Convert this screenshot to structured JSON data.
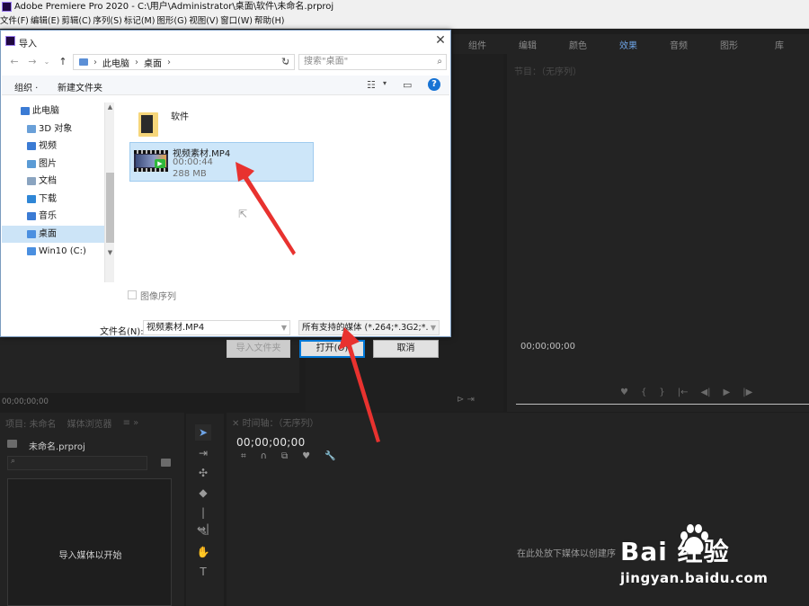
{
  "app": {
    "title": "Adobe Premiere Pro 2020 - C:\\用户\\Administrator\\桌面\\软件\\未命名.prproj",
    "menu": [
      "文件(F)",
      "编辑(E)",
      "剪辑(C)",
      "序列(S)",
      "标记(M)",
      "图形(G)",
      "视图(V)",
      "窗口(W)",
      "帮助(H)"
    ]
  },
  "workspace": {
    "tabs": [
      "组件",
      "编辑",
      "颜色",
      "效果",
      "音频",
      "图形",
      "库"
    ],
    "active_tab": "效果",
    "program_title": "节目：（无序列）",
    "program_timecode": "00;00;00;00",
    "source_timecode": "00;00;00;00",
    "project_tabs": [
      "项目: 未命名",
      "媒体浏览器"
    ],
    "project_file": "未命名.prproj",
    "project_empty": "导入媒体以开始",
    "timeline_tab": "时间轴：（无序列）",
    "timeline_timecode": "00;00;00;00",
    "timeline_drop_hint": "在此处放下媒体以创建序",
    "icons": {
      "tools": [
        "selection-tool-icon",
        "track-select-icon",
        "ripple-edit-icon",
        "razor-icon",
        "slip-icon",
        "pen-icon",
        "hand-icon",
        "type-icon"
      ]
    }
  },
  "dialog": {
    "title": "导入",
    "breadcrumb": [
      "此电脑",
      "桌面"
    ],
    "search_placeholder": "搜索\"桌面\"",
    "organize": "组织 ·",
    "new_folder": "新建文件夹",
    "tree": [
      {
        "label": "此电脑",
        "icon": "pc-icon",
        "color": "#3b7bd4"
      },
      {
        "label": "3D 对象",
        "icon": "objects-3d-icon",
        "color": "#6aa0d8"
      },
      {
        "label": "视频",
        "icon": "video-folder-icon",
        "color": "#3b7bd4"
      },
      {
        "label": "图片",
        "icon": "pictures-folder-icon",
        "color": "#5b9bd5"
      },
      {
        "label": "文档",
        "icon": "documents-folder-icon",
        "color": "#8aa4c0"
      },
      {
        "label": "下载",
        "icon": "downloads-folder-icon",
        "color": "#2f86d6"
      },
      {
        "label": "音乐",
        "icon": "music-folder-icon",
        "color": "#3b7bd4"
      },
      {
        "label": "桌面",
        "icon": "desktop-folder-icon",
        "color": "#4a8fe0"
      },
      {
        "label": "Win10 (C:)",
        "icon": "drive-icon",
        "color": "#4a8fe0"
      }
    ],
    "selected_tree_item": "桌面",
    "items": [
      {
        "name": "软件",
        "type": "folder"
      },
      {
        "name": "视频素材.MP4",
        "duration": "00:00:44",
        "size": "288 MB",
        "type": "video",
        "selected": true
      }
    ],
    "image_sequence_label": "图像序列",
    "filename_label": "文件名(N):",
    "filename_value": "视频素材.MP4",
    "filetype_value": "所有支持的媒体 (*.264;*.3G2;*.",
    "buttons": {
      "import_folder": "导入文件夹",
      "open": "打开(O)",
      "cancel": "取消"
    }
  },
  "watermark": {
    "brand": "Bai  经验",
    "site": "jingyan.baidu.com"
  },
  "colors": {
    "accent_blue": "#6ea4e6",
    "arrow_red": "#e8322f",
    "selection": "#cde6f9"
  }
}
